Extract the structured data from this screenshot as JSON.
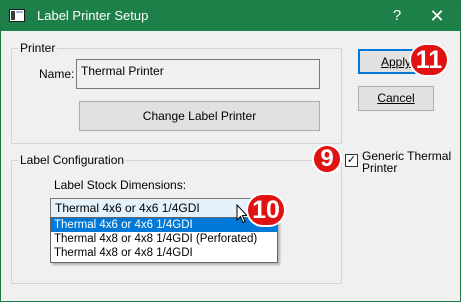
{
  "window": {
    "title": "Label Printer Setup",
    "help_glyph": "?",
    "close_glyph": "✕",
    "titlebar_color": "#1e8049"
  },
  "printer": {
    "group_label": "Printer",
    "name_label": "Name:",
    "name_value": "Thermal Printer",
    "change_button": "Change Label Printer"
  },
  "actions": {
    "apply_label": "Apply",
    "cancel_label": "Cancel"
  },
  "generic": {
    "checked": true,
    "check_glyph": "✓",
    "label": "Generic Thermal Printer"
  },
  "config": {
    "group_label": "Label Configuration",
    "stock_label": "Label Stock Dimensions:",
    "selected_value": "Thermal 4x6 or 4x6 1/4GDI",
    "options": [
      "Thermal 4x6 or 4x6 1/4GDI",
      "Thermal 4x8 or 4x8 1/4GDI (Perforated)",
      "Thermal 4x8 or 4x8 1/4GDI"
    ],
    "highlighted_option_index": 0
  },
  "annotations": {
    "badge_apply": "11",
    "badge_checkbox": "9",
    "badge_dropdown": "10",
    "badge_color": "#e01212"
  }
}
